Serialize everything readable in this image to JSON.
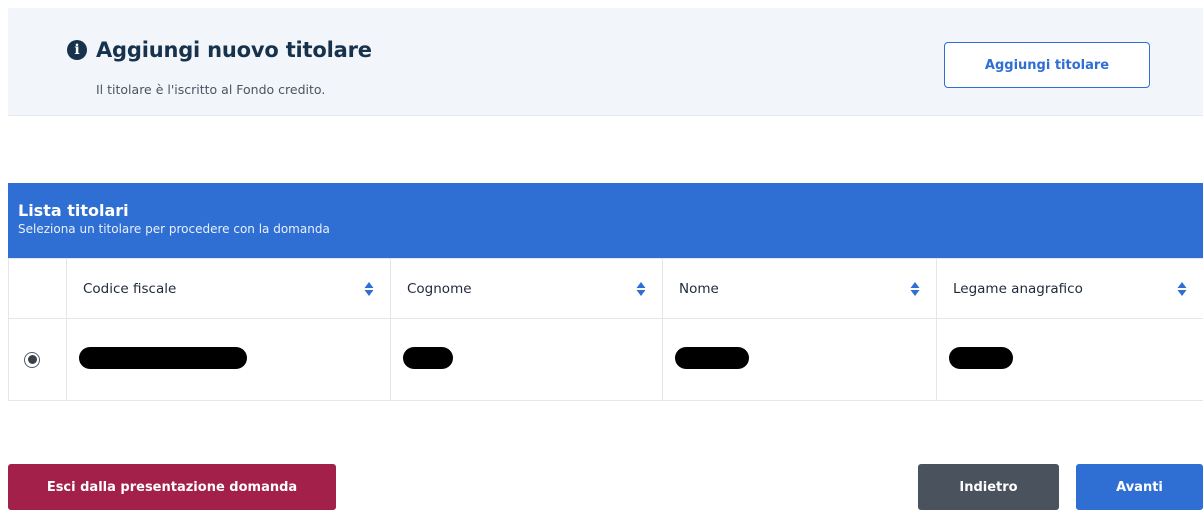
{
  "add_panel": {
    "title": "Aggiungi nuovo titolare",
    "subtitle": "Il titolare è l'iscritto al Fondo credito.",
    "button_label": "Aggiungi titolare",
    "icon": "info-icon"
  },
  "list": {
    "title": "Lista titolari",
    "subtitle": "Seleziona un titolare per procedere con la domanda",
    "columns": [
      "Codice fiscale",
      "Cognome",
      "Nome",
      "Legame anagrafico"
    ],
    "rows": [
      {
        "selected": true,
        "codice_fiscale": "[redacted]",
        "cognome": "[redacted]",
        "nome": "[redacted]",
        "legame_anagrafico": "[redacted]"
      }
    ]
  },
  "footer": {
    "exit_label": "Esci dalla presentazione domanda",
    "back_label": "Indietro",
    "next_label": "Avanti"
  },
  "colors": {
    "primary": "#2f6fd3",
    "danger": "#a3204a",
    "secondary": "#4a525e",
    "panel_bg": "#f2f5f9",
    "heading": "#17324d"
  }
}
